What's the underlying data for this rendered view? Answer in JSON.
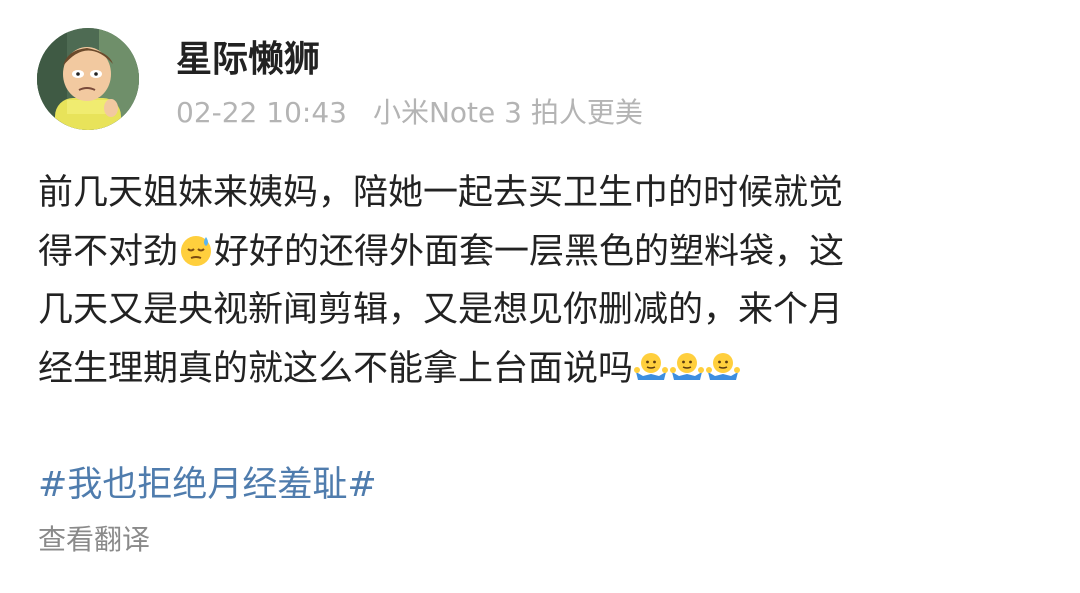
{
  "post": {
    "username": "星际懒狮",
    "timestamp": "02-22 10:43",
    "source": "小米Note 3 拍人更美",
    "avatar_icon": "cartoon-character-avatar",
    "content": {
      "line1": "前几天姐妹来姨妈，陪她一起去买卫生巾的时候就觉",
      "line2_a": "得不对劲",
      "line2_emoji": "sweat-face-emoji",
      "line2_b": "好好的还得外面套一层黑色的塑料袋，这",
      "line3": "几天又是央视新闻剪辑，又是想见你删减的，来个月",
      "line4": "经生理期真的就这么不能拿上台面说吗",
      "line4_emojis": [
        "shrug-emoji",
        "shrug-emoji",
        "shrug-emoji"
      ]
    },
    "topic": "#我也拒绝月经羞耻#",
    "translate_label": "查看翻译",
    "colors": {
      "text": "#222222",
      "meta": "#b4b4b4",
      "topic": "#4f7cad",
      "translate": "#8a8a8a"
    }
  }
}
